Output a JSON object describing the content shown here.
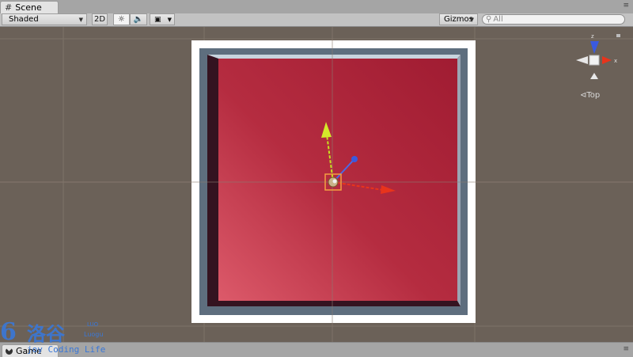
{
  "scene_tab": {
    "label": "Scene",
    "grid_icon": "#"
  },
  "toolbar": {
    "render_mode": "Shaded",
    "mode_2d": "2D",
    "gizmos": "Gizmos",
    "search_placeholder": "All"
  },
  "gizmo": {
    "view_label": "Top"
  },
  "game_tab": {
    "label": "Game"
  },
  "watermark": {
    "logo_glyph": "6",
    "han": "洛谷",
    "small_top": "LUO",
    "small_mid": "Luogu",
    "tagline": "joy Coding Life"
  },
  "colors": {
    "viewport_bg": "#6b6158",
    "floor": "#b0283a",
    "wall": "#ffffff",
    "x_axis": "#e8341c",
    "y_axis": "#c8e020",
    "z_axis": "#3a5ae0"
  }
}
